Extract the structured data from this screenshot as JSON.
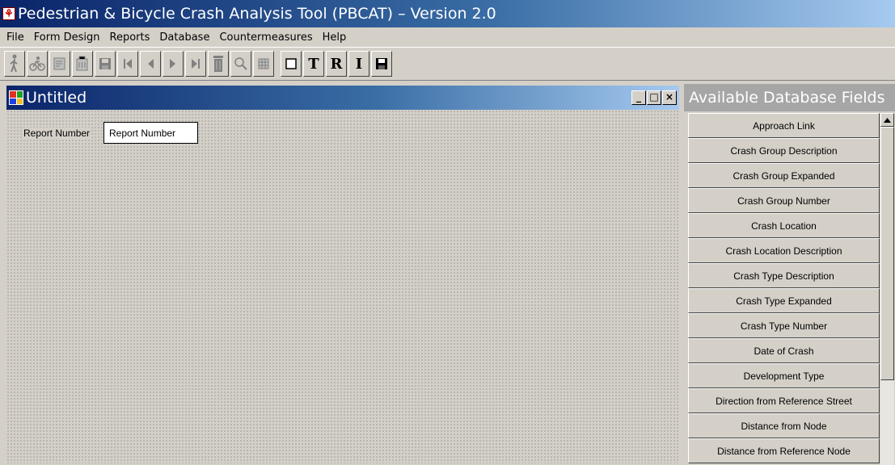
{
  "app": {
    "title": "Pedestrian & Bicycle Crash Analysis Tool (PBCAT) – Version 2.0",
    "icon": "pbcat-app-icon"
  },
  "menu": [
    {
      "label": "File"
    },
    {
      "label": "Form Design"
    },
    {
      "label": "Reports"
    },
    {
      "label": "Database"
    },
    {
      "label": "Countermeasures"
    },
    {
      "label": "Help"
    }
  ],
  "toolbar": {
    "letter_t": "T",
    "letter_r": "R",
    "letter_i": "I"
  },
  "form_window": {
    "title": "Untitled",
    "minimize": "_",
    "maximize": "□",
    "close": "×",
    "field_label": "Report Number",
    "field_value": "Report Number"
  },
  "fields_panel": {
    "title": "Available Database Fields",
    "items": [
      {
        "label": "Approach Link"
      },
      {
        "label": "Crash Group Description"
      },
      {
        "label": "Crash Group Expanded"
      },
      {
        "label": "Crash Group Number"
      },
      {
        "label": "Crash Location"
      },
      {
        "label": "Crash Location Description"
      },
      {
        "label": "Crash Type Description"
      },
      {
        "label": "Crash Type Expanded"
      },
      {
        "label": "Crash Type Number"
      },
      {
        "label": "Date of Crash"
      },
      {
        "label": "Development Type"
      },
      {
        "label": "Direction from Reference Street"
      },
      {
        "label": "Distance from Node"
      },
      {
        "label": "Distance from Reference Node"
      }
    ]
  },
  "colors": {
    "titlebar_start": "#0a246a",
    "titlebar_end": "#a6caf0",
    "window_bg": "#d4d0c8",
    "panel_title_bg": "#a6a6a6"
  }
}
